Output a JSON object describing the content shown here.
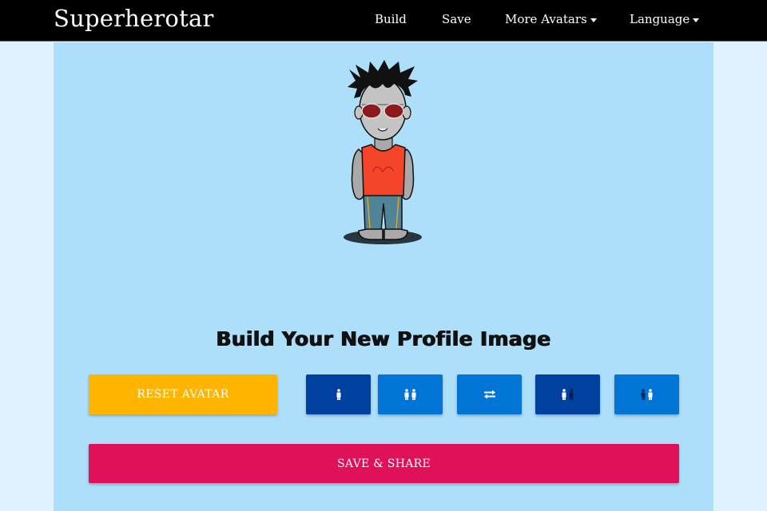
{
  "navbar": {
    "brand": "Superherotar",
    "links": [
      {
        "label": "Build",
        "has_dropdown": false
      },
      {
        "label": "Save",
        "has_dropdown": false
      },
      {
        "label": "More Avatars",
        "has_dropdown": true
      },
      {
        "label": "Language",
        "has_dropdown": true
      }
    ]
  },
  "main": {
    "heading": "Build Your New Profile Image",
    "reset_button": "RESET AVATAR",
    "icon_buttons": [
      {
        "icon": "single-person-icon",
        "active": true
      },
      {
        "icon": "two-persons-icon",
        "active": false
      },
      {
        "icon": "swap-arrows-icon",
        "active": false
      },
      {
        "icon": "person-pair-left-icon",
        "active": true
      },
      {
        "icon": "person-pair-right-icon",
        "active": false
      }
    ],
    "save_button": "SAVE & SHARE"
  },
  "colors": {
    "navbar": "#000000",
    "page_background": "#e0f2fd",
    "content_background": "#addffb",
    "reset_button": "#ffb400",
    "icon_button_dark": "#0041a0",
    "icon_button_light": "#0075d6",
    "save_button": "#e0115a"
  }
}
